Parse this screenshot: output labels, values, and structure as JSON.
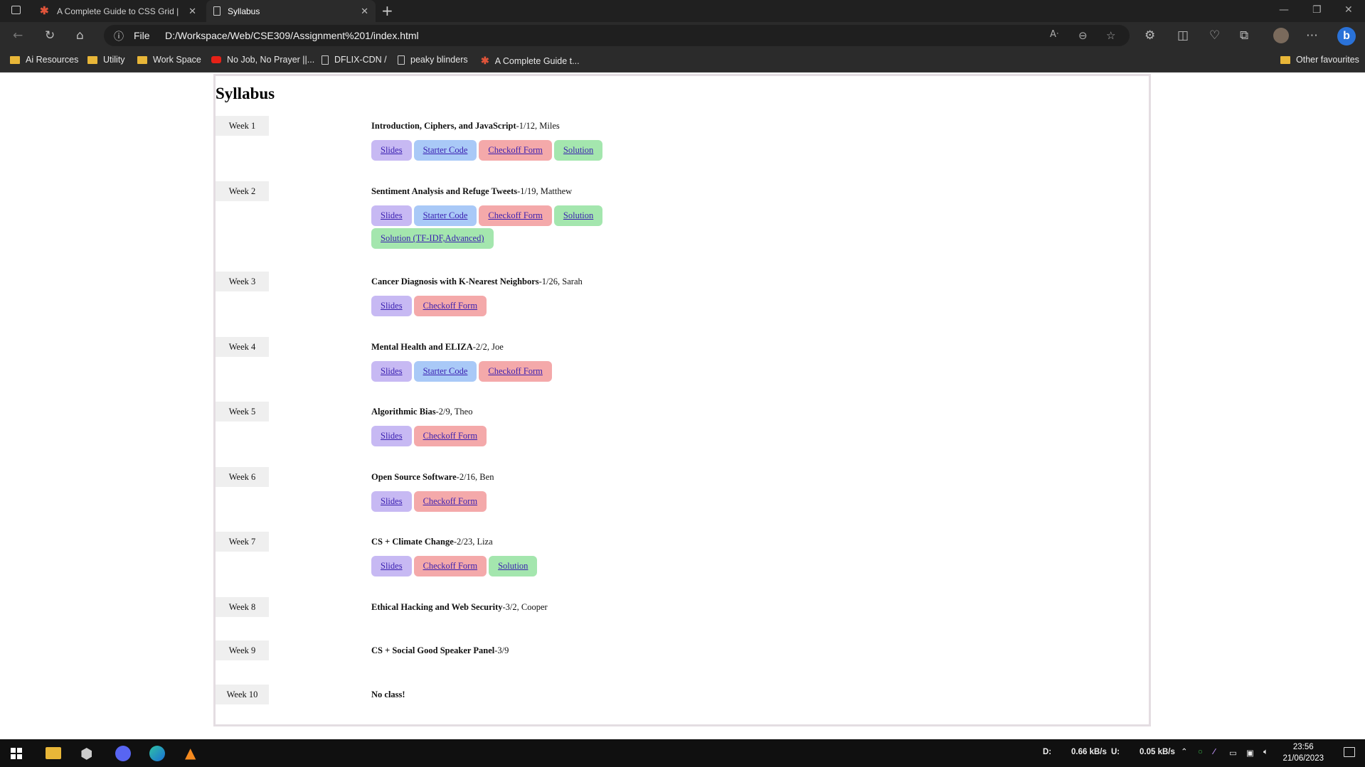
{
  "browser": {
    "tabs": [
      {
        "label": "A Complete Guide to CSS Grid |"
      },
      {
        "label": "Syllabus"
      }
    ],
    "address": {
      "scheme_label": "File",
      "url": "D:/Workspace/Web/CSE309/Assignment%201/index.html"
    },
    "bookmarks": [
      {
        "label": "Ai Resources"
      },
      {
        "label": "Utility"
      },
      {
        "label": "Work Space"
      },
      {
        "label": "No Job, No Prayer ||..."
      },
      {
        "label": "DFLIX-CDN /"
      },
      {
        "label": "peaky blinders"
      },
      {
        "label": "A Complete Guide t..."
      }
    ],
    "other_favourites": "Other favourites"
  },
  "page": {
    "title": "Syllabus",
    "weeks": [
      {
        "week": "Week 1",
        "title": "Introduction, Ciphers, and JavaScript",
        "meta": "-1/12, Miles",
        "links": [
          {
            "label": "Slides",
            "kind": "slides"
          },
          {
            "label": "Starter Code",
            "kind": "starter"
          },
          {
            "label": "Checkoff Form",
            "kind": "checkoff"
          },
          {
            "label": "Solution",
            "kind": "solution"
          }
        ]
      },
      {
        "week": "Week 2",
        "title": "Sentiment Analysis and Refuge Tweets",
        "meta": "-1/19, Matthew",
        "links": [
          {
            "label": "Slides",
            "kind": "slides"
          },
          {
            "label": "Starter Code",
            "kind": "starter"
          },
          {
            "label": "Checkoff Form",
            "kind": "checkoff"
          },
          {
            "label": "Solution",
            "kind": "solution"
          },
          {
            "label": "Solution (TF-IDF,Advanced)",
            "kind": "solution"
          }
        ]
      },
      {
        "week": "Week 3",
        "title": "Cancer Diagnosis with K-Nearest Neighbors",
        "meta": "-1/26, Sarah",
        "links": [
          {
            "label": "Slides",
            "kind": "slides"
          },
          {
            "label": "Checkoff Form",
            "kind": "checkoff"
          }
        ]
      },
      {
        "week": "Week 4",
        "title": "Mental Health and ELIZA",
        "meta": "-2/2, Joe",
        "links": [
          {
            "label": "Slides",
            "kind": "slides"
          },
          {
            "label": "Starter Code",
            "kind": "starter"
          },
          {
            "label": "Checkoff Form",
            "kind": "checkoff"
          }
        ]
      },
      {
        "week": "Week 5",
        "title": "Algorithmic Bias",
        "meta": "-2/9, Theo",
        "links": [
          {
            "label": "Slides",
            "kind": "slides"
          },
          {
            "label": "Checkoff Form",
            "kind": "checkoff"
          }
        ]
      },
      {
        "week": "Week 6",
        "title": "Open Source Software",
        "meta": "-2/16, Ben",
        "links": [
          {
            "label": "Slides",
            "kind": "slides"
          },
          {
            "label": "Checkoff Form",
            "kind": "checkoff"
          }
        ]
      },
      {
        "week": "Week 7",
        "title": "CS + Climate Change",
        "meta": "-2/23, Liza",
        "links": [
          {
            "label": "Slides",
            "kind": "slides"
          },
          {
            "label": "Checkoff Form",
            "kind": "checkoff"
          },
          {
            "label": "Solution",
            "kind": "solution"
          }
        ]
      },
      {
        "week": "Week 8",
        "title": "Ethical Hacking and Web Security",
        "meta": "-3/2, Cooper",
        "links": []
      },
      {
        "week": "Week 9",
        "title": "CS + Social Good Speaker Panel",
        "meta": "-3/9",
        "links": []
      },
      {
        "week": "Week 10",
        "title": "No class!",
        "meta": "",
        "links": []
      }
    ]
  },
  "taskbar": {
    "net_down_label": "D:",
    "net_down": "0.66 kB/s",
    "net_up_label": "U:",
    "net_up": "0.05 kB/s",
    "time": "23:56",
    "date": "21/06/2023"
  },
  "colors": {
    "slides": "#c7b9f3",
    "starter": "#a9c9f7",
    "checkoff": "#f4a9aa",
    "solution": "#a4e6ae",
    "link_text": "#3a1fb0"
  }
}
